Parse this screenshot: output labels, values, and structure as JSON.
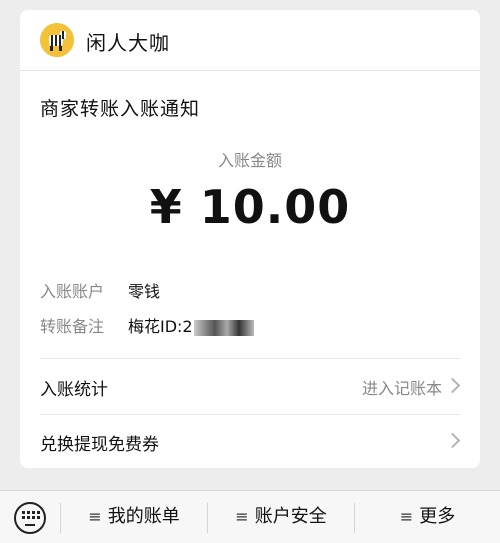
{
  "header": {
    "app_name": "闲人大咖",
    "avatar_icon": "zebra-avatar-icon"
  },
  "notice": {
    "title": "商家转账入账通知",
    "amount_label": "入账金额",
    "amount": "¥ 10.00",
    "rows": [
      {
        "label": "入账账户",
        "value": "零钱"
      },
      {
        "label": "转账备注",
        "value": "梅花ID:2"
      }
    ]
  },
  "list": [
    {
      "label": "入账统计",
      "hint": "进入记账本"
    },
    {
      "label": "兑换提现免费券",
      "hint": ""
    }
  ],
  "bottom_menu": {
    "keyboard_icon": "keyboard-icon",
    "items": [
      {
        "label": "我的账单"
      },
      {
        "label": "账户安全"
      },
      {
        "label": "更多"
      }
    ]
  }
}
